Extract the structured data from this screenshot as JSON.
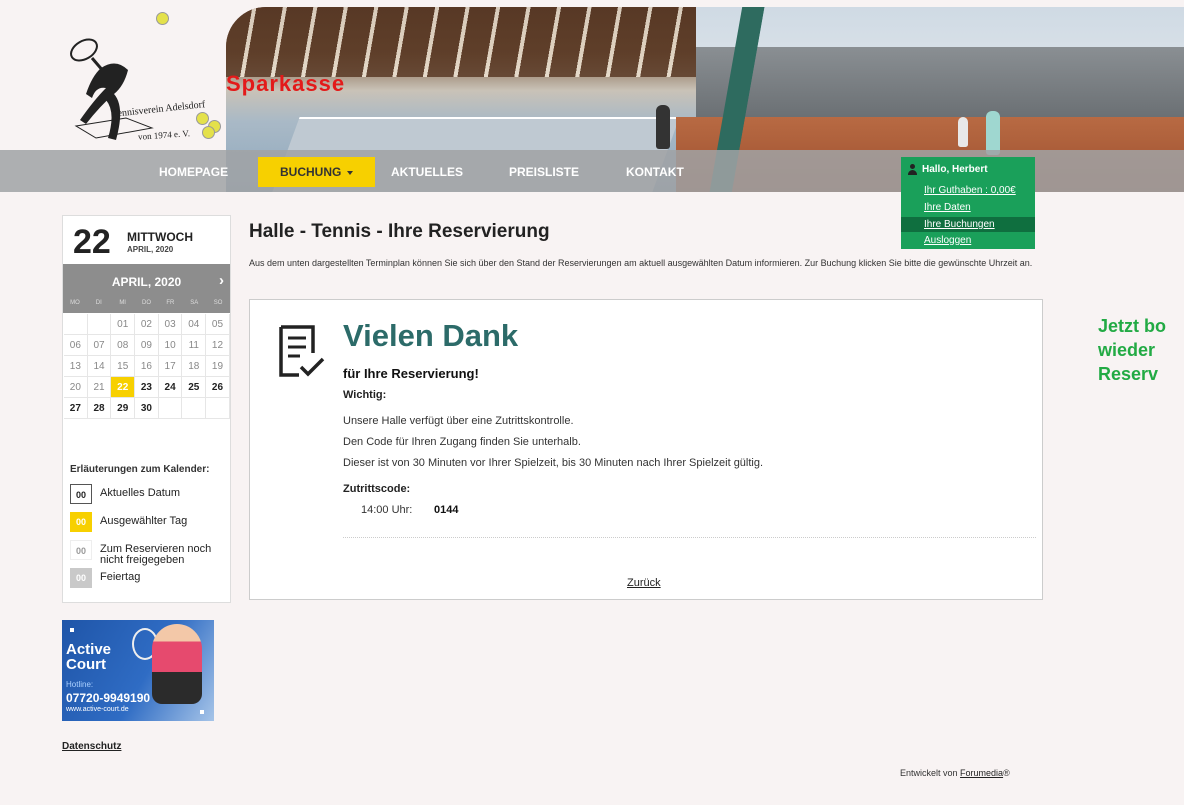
{
  "header": {
    "logo": {
      "club_name": "Tennisverein Adelsdorf",
      "founded": "von 1974 e. V."
    },
    "banner": {
      "sign_text": "Sparkasse"
    }
  },
  "nav": {
    "items": [
      {
        "label": "HOMEPAGE"
      },
      {
        "label": "BUCHUNG"
      },
      {
        "label": "AKTUELLES"
      },
      {
        "label": "PREISLISTE"
      },
      {
        "label": "KONTAKT"
      }
    ],
    "active_index": 1
  },
  "user_menu": {
    "greeting": "Hallo, Herbert",
    "balance": "Ihr Guthaben : 0,00€",
    "data": "Ihre Daten",
    "bookings": "Ihre Buchungen",
    "logout": "Ausloggen"
  },
  "calendar": {
    "day_number": "22",
    "weekday": "MITTWOCH",
    "month_small": "APRIL, 2020",
    "month_label": "APRIL, 2020",
    "next_arrow": "›",
    "weekdays": [
      "MO",
      "DI",
      "MI",
      "DO",
      "FR",
      "SA",
      "SO"
    ],
    "weeks": [
      [
        "",
        "",
        "01",
        "02",
        "03",
        "04",
        "05"
      ],
      [
        "06",
        "07",
        "08",
        "09",
        "10",
        "11",
        "12"
      ],
      [
        "13",
        "14",
        "15",
        "16",
        "17",
        "18",
        "19"
      ],
      [
        "20",
        "21",
        "22",
        "23",
        "24",
        "25",
        "26"
      ],
      [
        "27",
        "28",
        "29",
        "30",
        "",
        "",
        ""
      ]
    ],
    "selected_day": "22",
    "bookable_days": [
      "23",
      "24",
      "25",
      "26",
      "27",
      "28",
      "29",
      "30"
    ],
    "legend_title": "Erläuterungen zum Kalender:",
    "legend": [
      {
        "box": "00",
        "label": "Aktuelles Datum",
        "kind": "today"
      },
      {
        "box": "00",
        "label": "Ausgewählter Tag",
        "kind": "selected"
      },
      {
        "box": "00",
        "label": "Zum Reservieren noch nicht freigegeben",
        "kind": "locked"
      },
      {
        "box": "00",
        "label": "Feiertag",
        "kind": "holiday"
      }
    ]
  },
  "ad": {
    "title_line1": "Active",
    "title_line2": "Court",
    "hotline_label": "Hotline:",
    "phone": "07720-9949190",
    "url": "www.active-court.de"
  },
  "datenschutz": "Datenschutz",
  "main": {
    "title": "Halle - Tennis - Ihre Reservierung",
    "intro": "Aus dem unten dargestellten Terminplan können Sie sich über den Stand der Reservierungen am aktuell ausgewählten Datum informieren. Zur Buchung klicken Sie bitte die gewünschte Uhrzeit an."
  },
  "confirmation": {
    "heading": "Vielen Dank",
    "subheading": "für Ihre Reservierung!",
    "important_label": "Wichtig:",
    "lines": [
      "Unsere Halle verfügt über eine Zutrittskontrolle.",
      "Den Code für Ihren Zugang finden Sie unterhalb.",
      "Dieser ist von 30 Minuten vor Ihrer Spielzeit, bis 30 Minuten nach Ihrer Spielzeit gültig."
    ],
    "code_label": "Zutrittscode:",
    "code_time": "14:00 Uhr:",
    "code_value": "0144",
    "back_link": "Zurück"
  },
  "promo": {
    "line1": "Jetzt bo",
    "line2": "wieder",
    "line3": "Reserv"
  },
  "footer": {
    "prefix": "Entwickelt von",
    "link": "Forumedia",
    "suffix": "®"
  },
  "colors": {
    "accent_yellow": "#f7d000",
    "user_menu_green": "#1aa05a",
    "heading_teal": "#2c6b69",
    "promo_green": "#22aa44",
    "nav_grey": "#a0a2a4"
  }
}
